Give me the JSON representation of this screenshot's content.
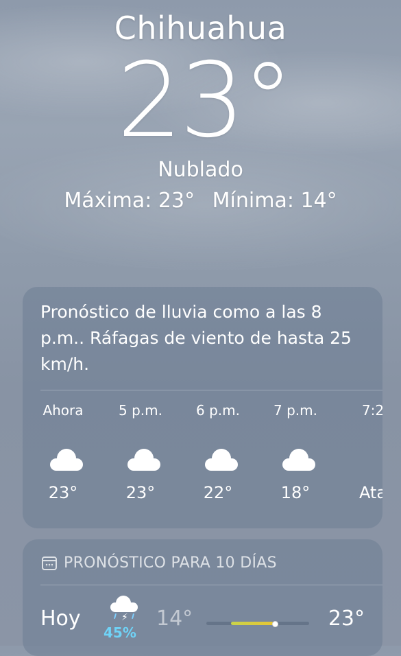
{
  "location": {
    "city": "Chihuahua",
    "current_temp": "23°",
    "condition": "Nublado",
    "high_label": "Máxima: 23°",
    "low_label": "Mínima: 14°"
  },
  "hourly": {
    "summary": "Pronóstico de lluvia como a las 8 p.m.. Ráfagas de viento de hasta 25 km/h.",
    "items": [
      {
        "time": "Ahora",
        "icon": "cloud-icon",
        "temp": "23°"
      },
      {
        "time": "5 p.m.",
        "icon": "cloud-icon",
        "temp": "23°"
      },
      {
        "time": "6 p.m.",
        "icon": "cloud-icon",
        "temp": "22°"
      },
      {
        "time": "7 p.m.",
        "icon": "cloud-icon",
        "temp": "18°"
      },
      {
        "time": "7:2",
        "icon": "sunset-icon",
        "temp": "Ata"
      }
    ]
  },
  "daily": {
    "title": "PRONÓSTICO PARA 10 DÍAS",
    "title_icon": "calendar-icon",
    "days": [
      {
        "name": "Hoy",
        "icon": "thunderstorm-icon",
        "precip": "45%",
        "low": "14°",
        "high": "23°"
      }
    ]
  },
  "colors": {
    "precip": "#6fd3f7",
    "range_gradient_start": "#c9d34a",
    "range_gradient_end": "#e7c534"
  }
}
